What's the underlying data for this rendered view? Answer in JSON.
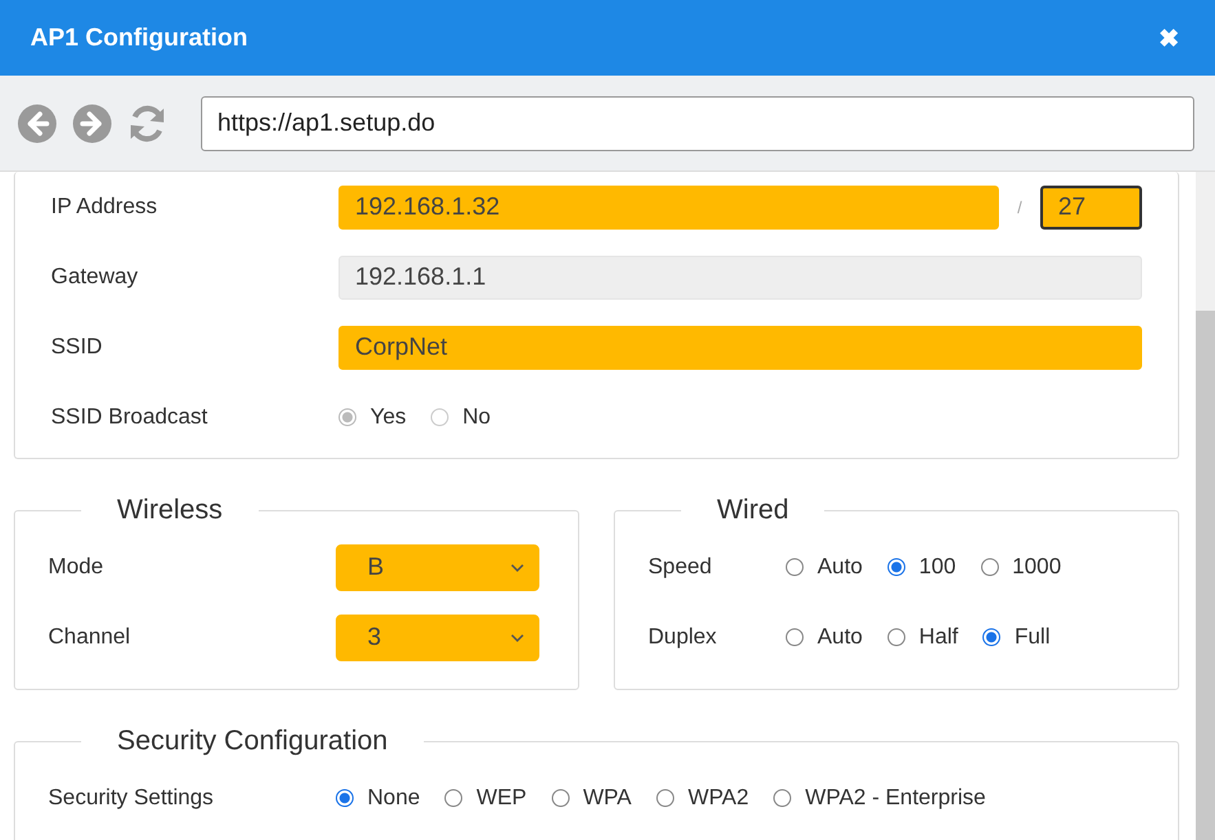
{
  "window": {
    "title": "AP1 Configuration",
    "close": "✖"
  },
  "address_bar": {
    "value": "https://ap1.setup.do"
  },
  "network": {
    "rows": [
      {
        "kind": "ip",
        "label": "IP Address",
        "value": "192.168.1.32",
        "highlighted": true,
        "separator": "/",
        "prefix": "27",
        "prefix_focused": true
      },
      {
        "kind": "text",
        "label": "Gateway",
        "value": "192.168.1.1",
        "highlighted": false,
        "disabled": true
      },
      {
        "kind": "text",
        "label": "SSID",
        "value": "CorpNet",
        "highlighted": true,
        "disabled": false
      },
      {
        "kind": "radio",
        "label": "SSID Broadcast",
        "disabled": true,
        "options": [
          {
            "label": "Yes",
            "selected": true
          },
          {
            "label": "No",
            "selected": false
          }
        ]
      }
    ]
  },
  "wireless": {
    "title": "Wireless",
    "rows": [
      {
        "label": "Mode",
        "value": "B",
        "highlighted": true
      },
      {
        "label": "Channel",
        "value": "3",
        "highlighted": true
      }
    ]
  },
  "wired": {
    "title": "Wired",
    "rows": [
      {
        "label": "Speed",
        "options": [
          {
            "label": "Auto",
            "selected": false
          },
          {
            "label": "100",
            "selected": true
          },
          {
            "label": "1000",
            "selected": false
          }
        ]
      },
      {
        "label": "Duplex",
        "options": [
          {
            "label": "Auto",
            "selected": false
          },
          {
            "label": "Half",
            "selected": false
          },
          {
            "label": "Full",
            "selected": true
          }
        ]
      }
    ]
  },
  "security": {
    "title": "Security Configuration",
    "rows": [
      {
        "label": "Security Settings",
        "options": [
          {
            "label": "None",
            "selected": true
          },
          {
            "label": "WEP",
            "selected": false
          },
          {
            "label": "WPA",
            "selected": false
          },
          {
            "label": "WPA2",
            "selected": false
          },
          {
            "label": "WPA2 - Enterprise",
            "selected": false
          }
        ]
      }
    ]
  }
}
